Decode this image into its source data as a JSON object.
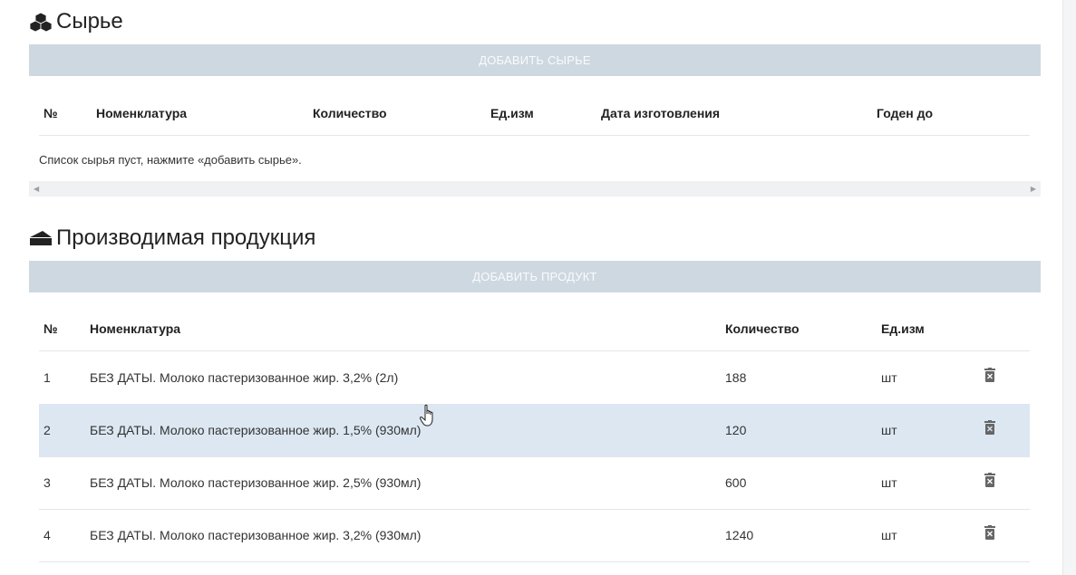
{
  "raw": {
    "title": "Сырье",
    "icon": "cubes-icon",
    "add_label": "ДОБАВИТЬ СЫРЬЕ",
    "columns": [
      "№",
      "Номенклатура",
      "Количество",
      "Ед.изм",
      "Дата изготовления",
      "Годен до"
    ],
    "empty_text": "Список сырья пуст, нажмите «добавить сырье»."
  },
  "products": {
    "title": "Производимая продукция",
    "icon": "cheese-icon",
    "add_label": "ДОБАВИТЬ ПРОДУКТ",
    "columns": [
      "№",
      "Номенклатура",
      "Количество",
      "Ед.изм"
    ],
    "rows": [
      {
        "num": "1",
        "name": "БЕЗ ДАТЫ. Молоко пастеризованное жир. 3,2% (2л)",
        "qty": "188",
        "unit": "шт"
      },
      {
        "num": "2",
        "name": "БЕЗ ДАТЫ. Молоко пастеризованное жир. 1,5% (930мл)",
        "qty": "120",
        "unit": "шт"
      },
      {
        "num": "3",
        "name": "БЕЗ ДАТЫ. Молоко пастеризованное жир. 2,5% (930мл)",
        "qty": "600",
        "unit": "шт"
      },
      {
        "num": "4",
        "name": "БЕЗ ДАТЫ. Молоко пастеризованное жир. 3,2% (930мл)",
        "qty": "1240",
        "unit": "шт"
      }
    ]
  },
  "colors": {
    "button_bg": "#ced8e0",
    "row_highlight": "#dce7f2"
  }
}
